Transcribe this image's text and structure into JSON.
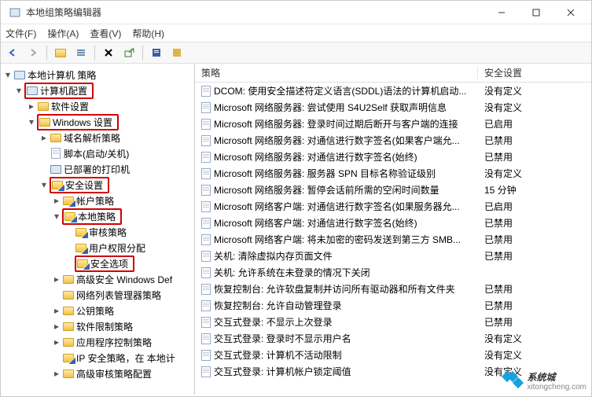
{
  "window": {
    "title": "本地组策略编辑器"
  },
  "menus": {
    "file": "文件(F)",
    "action": "操作(A)",
    "view": "查看(V)",
    "help": "帮助(H)"
  },
  "tree": {
    "root": "本地计算机 策略",
    "computerConfig": "计算机配置",
    "softwareSettings": "软件设置",
    "windowsSettings": "Windows 设置",
    "nameResolution": "域名解析策略",
    "scripts": "脚本(启动/关机)",
    "deployedPrinters": "已部署的打印机",
    "securitySettings": "安全设置",
    "accountPolicies": "帐户策略",
    "localPolicies": "本地策略",
    "auditPolicy": "审核策略",
    "userRights": "用户权限分配",
    "securityOptions": "安全选项",
    "advancedDefender": "高级安全 Windows Def",
    "networkList": "网络列表管理器策略",
    "publicKey": "公钥策略",
    "softwareRestriction": "软件限制策略",
    "appControl": "应用程序控制策略",
    "ipSecurity": "IP 安全策略，在 本地计",
    "advancedAudit": "高级审核策略配置"
  },
  "listHeader": {
    "policy": "策略",
    "setting": "安全设置"
  },
  "policies": [
    {
      "name": "DCOM: 使用安全描述符定义语言(SDDL)语法的计算机启动...",
      "value": "没有定义"
    },
    {
      "name": "Microsoft 网络服务器: 尝试使用 S4U2Self 获取声明信息",
      "value": "没有定义"
    },
    {
      "name": "Microsoft 网络服务器: 登录时间过期后断开与客户端的连接",
      "value": "已启用"
    },
    {
      "name": "Microsoft 网络服务器: 对通信进行数字签名(如果客户端允...",
      "value": "已禁用"
    },
    {
      "name": "Microsoft 网络服务器: 对通信进行数字签名(始终)",
      "value": "已禁用"
    },
    {
      "name": "Microsoft 网络服务器: 服务器 SPN 目标名称验证级别",
      "value": "没有定义"
    },
    {
      "name": "Microsoft 网络服务器: 暂停会话前所需的空闲时间数量",
      "value": "15 分钟"
    },
    {
      "name": "Microsoft 网络客户端: 对通信进行数字签名(如果服务器允...",
      "value": "已启用"
    },
    {
      "name": "Microsoft 网络客户端: 对通信进行数字签名(始终)",
      "value": "已禁用"
    },
    {
      "name": "Microsoft 网络客户端: 将未加密的密码发送到第三方 SMB...",
      "value": "已禁用"
    },
    {
      "name": "关机: 清除虚拟内存页面文件",
      "value": "已禁用"
    },
    {
      "name": "关机: 允许系统在未登录的情况下关闭",
      "value": ""
    },
    {
      "name": "恢复控制台: 允许软盘复制并访问所有驱动器和所有文件夹",
      "value": "已禁用"
    },
    {
      "name": "恢复控制台: 允许自动管理登录",
      "value": "已禁用"
    },
    {
      "name": "交互式登录: 不显示上次登录",
      "value": "已禁用"
    },
    {
      "name": "交互式登录: 登录时不显示用户名",
      "value": "没有定义"
    },
    {
      "name": "交互式登录: 计算机不活动限制",
      "value": "没有定义"
    },
    {
      "name": "交互式登录: 计算机帐户锁定阈值",
      "value": "没有定义"
    }
  ],
  "watermark": {
    "brand": "系统城",
    "url": "xitongcheng.com"
  }
}
